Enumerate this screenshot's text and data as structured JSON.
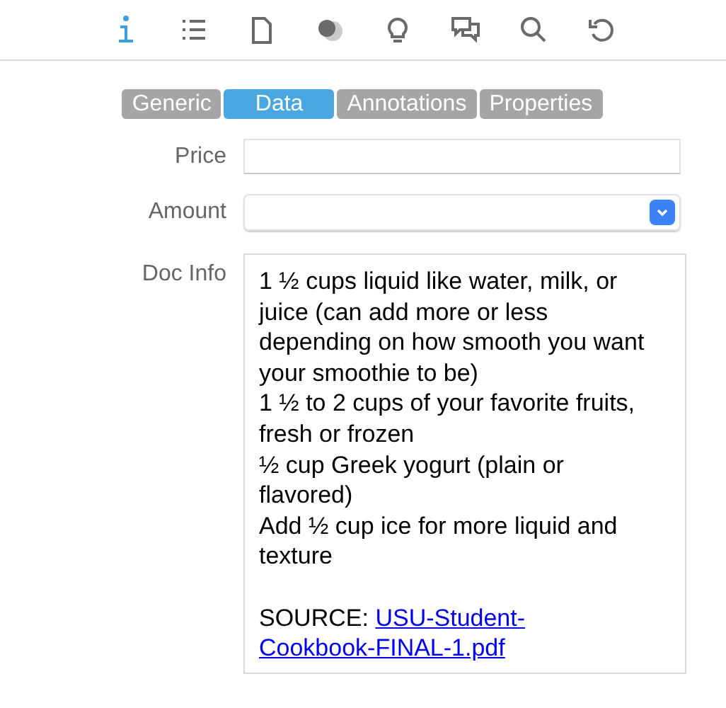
{
  "toolbar": [
    {
      "kind": "info",
      "selected": true
    },
    {
      "kind": "list",
      "selected": false
    },
    {
      "kind": "page",
      "selected": false
    },
    {
      "kind": "circles",
      "selected": false
    },
    {
      "kind": "bulb",
      "selected": false
    },
    {
      "kind": "chat",
      "selected": false
    },
    {
      "kind": "search",
      "selected": false
    },
    {
      "kind": "undo",
      "selected": false
    }
  ],
  "tabs": [
    {
      "label": "Generic",
      "selected": false
    },
    {
      "label": "Data",
      "selected": true
    },
    {
      "label": "Annotations",
      "selected": false
    },
    {
      "label": "Properties",
      "selected": false
    }
  ],
  "fields": [
    {
      "label": "Price",
      "kind": "text"
    },
    {
      "label": "Amount",
      "kind": "select"
    }
  ],
  "doc_info": {
    "label": "Doc Info",
    "paragraphs": [
      "1 ½ cups liquid like water, milk, or juice (can add more or less depending on how smooth you want your smoothie to be)",
      "1 ½ to 2 cups of your favorite fruits, fresh or frozen",
      "½ cup Greek yogurt (plain or flavored)",
      "Add ½ cup ice for more liquid and texture"
    ],
    "source_label": "SOURCE:",
    "link_lines": [
      "USU-Student-",
      "Cookbook-FINAL-1.pdf"
    ]
  }
}
